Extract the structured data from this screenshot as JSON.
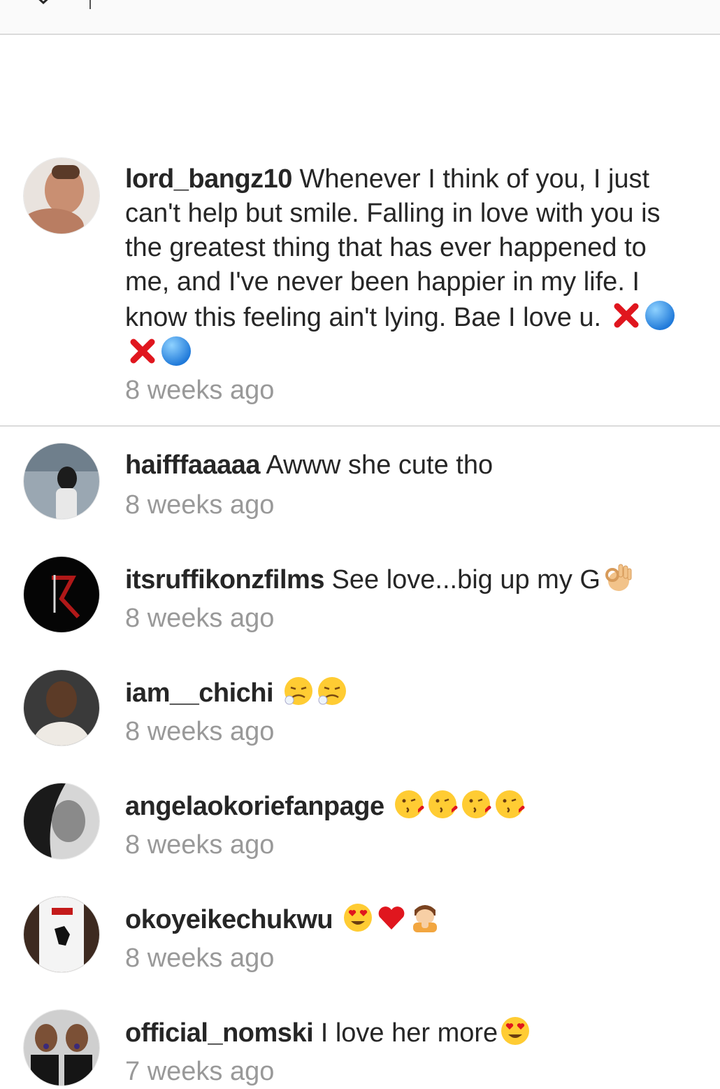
{
  "colors": {
    "text": "#262626",
    "timestamp": "#999999",
    "divider": "#dbdbdb",
    "topbar": "#fafafa"
  },
  "topbar": {
    "back_icon": "chevron-down-icon"
  },
  "caption": {
    "username": "lord_bangz10",
    "text": "Whenever I think of you, I just can't help but smile. Falling in love with you is the greatest thing that has ever happened to me, and I've never been happier in my life. I know this feeling ain't lying. Bae I love u.",
    "emojis": [
      "cross-mark-icon",
      "blue-circle-icon",
      "cross-mark-icon",
      "blue-circle-icon"
    ],
    "time": "8 weeks ago"
  },
  "comments": [
    {
      "username": "haifffaaaaa",
      "text": "Awww she cute tho",
      "emojis": [],
      "time": "8 weeks ago"
    },
    {
      "username": "itsruffikonzfilms",
      "text": "See love...big up my G",
      "emojis": [
        "ok-hand-icon"
      ],
      "time": "8 weeks ago"
    },
    {
      "username": "iam__chichi",
      "text": "",
      "emojis": [
        "persevering-face-icon",
        "persevering-face-icon"
      ],
      "time": "8 weeks ago"
    },
    {
      "username": "angelaokoriefanpage",
      "text": "",
      "emojis": [
        "kissing-face-icon",
        "kissing-face-icon",
        "kissing-face-icon",
        "kissing-face-icon"
      ],
      "time": "8 weeks ago"
    },
    {
      "username": "okoyeikechukwu",
      "text": "",
      "emojis": [
        "heart-eyes-face-icon",
        "red-heart-icon",
        "person-bowing-icon"
      ],
      "time": "8 weeks ago"
    },
    {
      "username": "official_nomski",
      "text": "I love her more",
      "emojis": [
        "heart-eyes-face-icon"
      ],
      "time": "7 weeks ago"
    }
  ]
}
